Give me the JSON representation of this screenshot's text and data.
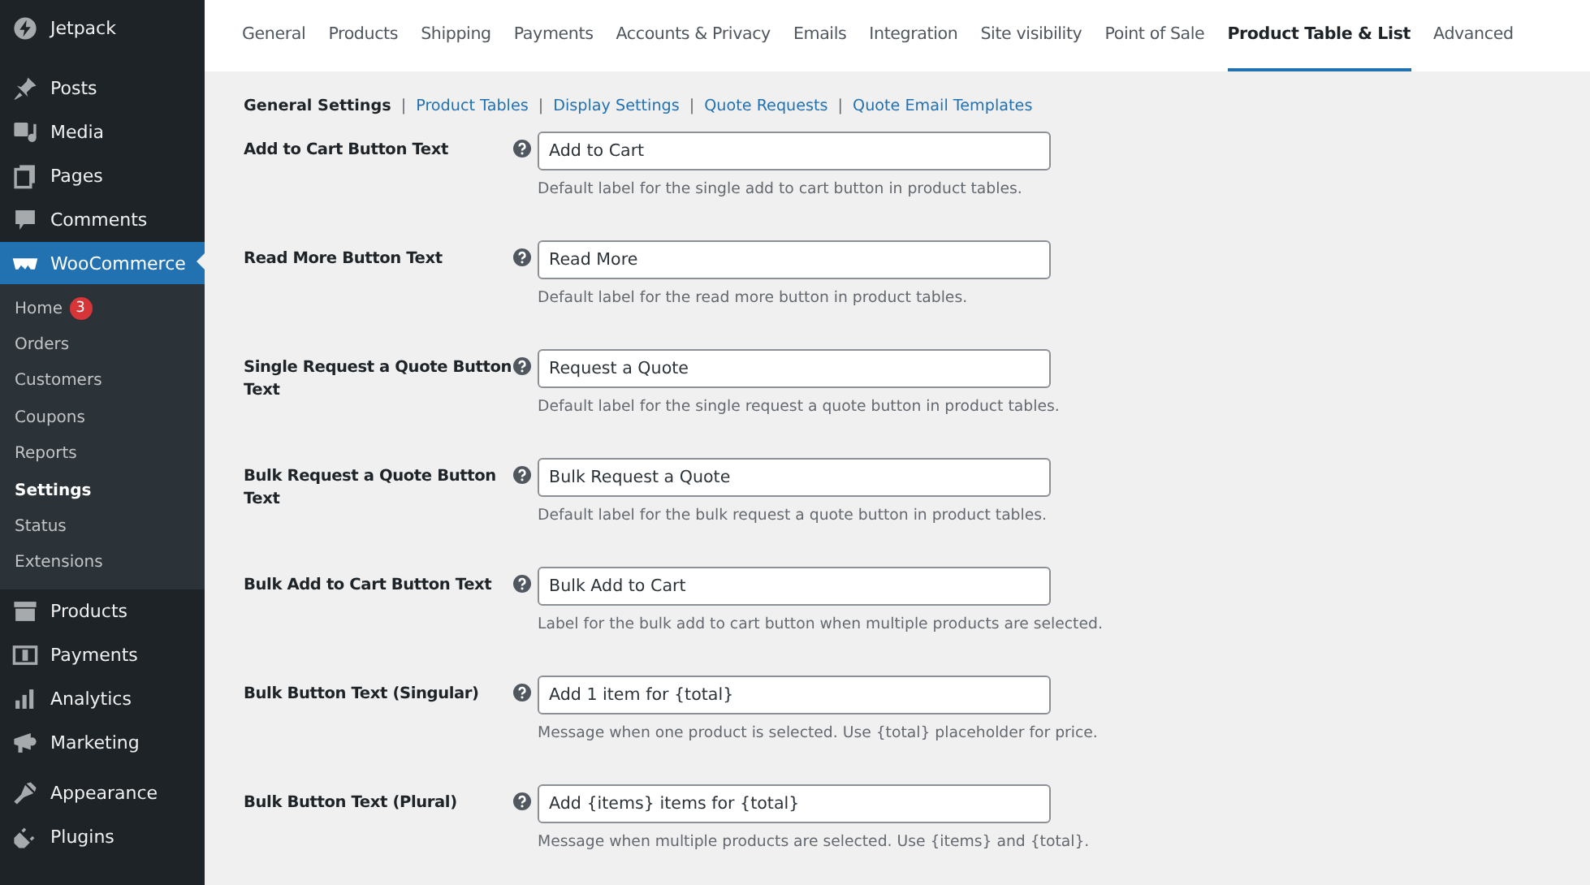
{
  "sidebar": {
    "groups": [
      [
        {
          "label": "Jetpack",
          "selected": false
        }
      ],
      [
        {
          "label": "Posts",
          "selected": false
        },
        {
          "label": "Media",
          "selected": false
        },
        {
          "label": "Pages",
          "selected": false
        },
        {
          "label": "Comments",
          "selected": false
        },
        {
          "label": "WooCommerce",
          "selected": true,
          "children": [
            {
              "label": "Home",
              "selected": false,
              "badge": "3"
            },
            {
              "label": "Orders",
              "selected": false
            },
            {
              "label": "Customers",
              "selected": false
            },
            {
              "label": "Coupons",
              "selected": false
            },
            {
              "label": "Reports",
              "selected": false
            },
            {
              "label": "Settings",
              "selected": true
            },
            {
              "label": "Status",
              "selected": false
            },
            {
              "label": "Extensions",
              "selected": false
            }
          ]
        },
        {
          "label": "Products",
          "selected": false
        },
        {
          "label": "Payments",
          "selected": false
        },
        {
          "label": "Analytics",
          "selected": false
        },
        {
          "label": "Marketing",
          "selected": false
        }
      ],
      [
        {
          "label": "Appearance",
          "selected": false
        },
        {
          "label": "Plugins",
          "selected": false
        }
      ]
    ]
  },
  "tabs": [
    {
      "label": "General",
      "selected": false
    },
    {
      "label": "Products",
      "selected": false
    },
    {
      "label": "Shipping",
      "selected": false
    },
    {
      "label": "Payments",
      "selected": false
    },
    {
      "label": "Accounts & Privacy",
      "selected": false
    },
    {
      "label": "Emails",
      "selected": false
    },
    {
      "label": "Integration",
      "selected": false
    },
    {
      "label": "Site visibility",
      "selected": false
    },
    {
      "label": "Point of Sale",
      "selected": false
    },
    {
      "label": "Product Table & List",
      "selected": true
    },
    {
      "label": "Advanced",
      "selected": false
    }
  ],
  "subnav": [
    {
      "label": "General Settings",
      "selected": true
    },
    {
      "separator": "|",
      "label": "Product Tables",
      "selected": false
    },
    {
      "separator": "|",
      "label": "Display Settings",
      "selected": false
    },
    {
      "separator": "|",
      "label": "Quote Requests",
      "selected": false
    },
    {
      "separator": "|",
      "label": "Quote Email Templates",
      "selected": false
    }
  ],
  "settings": [
    {
      "label": "Add to Cart Button Text",
      "value": "Add to Cart",
      "description": "Default label for the single add to cart button in product tables."
    },
    {
      "label": "Read More Button Text",
      "value": "Read More",
      "description": "Default label for the read more button in product tables."
    },
    {
      "label": "Single Request a Quote Button Text",
      "value": "Request a Quote",
      "description": "Default label for the single request a quote button in product tables."
    },
    {
      "label": "Bulk Request a Quote Button Text",
      "value": "Bulk Request a Quote",
      "description": "Default label for the bulk request a quote button in product tables."
    },
    {
      "label": "Bulk Add to Cart Button Text",
      "value": "Bulk Add to Cart",
      "description": "Label for the bulk add to cart button when multiple products are selected."
    },
    {
      "label": "Bulk Button Text (Singular)",
      "value": "Add 1 item for {total}",
      "description": "Message when one product is selected. Use {total} placeholder for price."
    },
    {
      "label": "Bulk Button Text (Plural)",
      "value": "Add {items} items for {total}",
      "description": "Message when multiple products are selected. Use {items} and {total}."
    }
  ]
}
